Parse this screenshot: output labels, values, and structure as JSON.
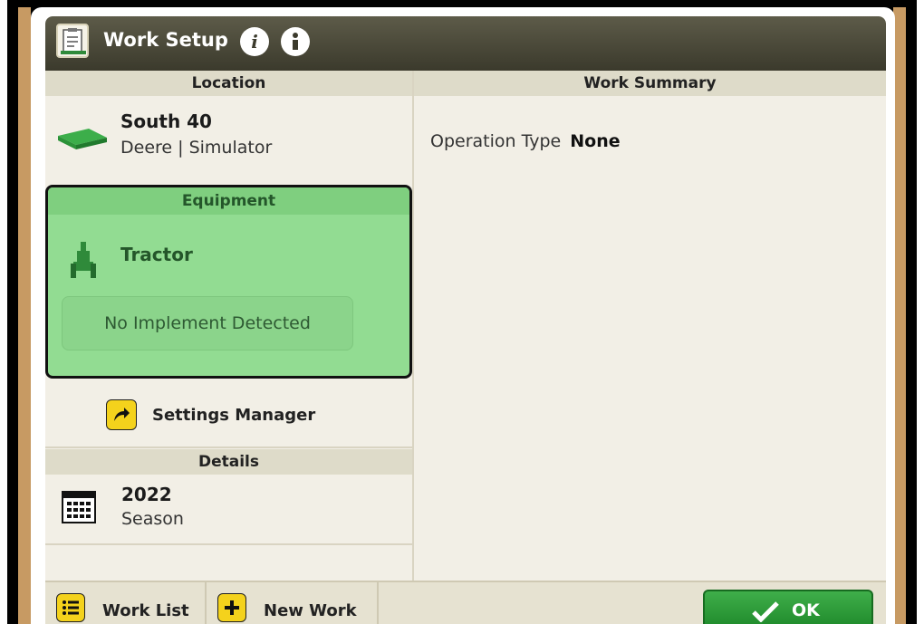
{
  "header": {
    "title": "Work Setup",
    "info_icons": [
      "info-icon",
      "info-detail-icon"
    ]
  },
  "location": {
    "header": "Location",
    "field_name": "South 40",
    "field_sub": "Deere | Simulator",
    "icon": "field-icon"
  },
  "equipment": {
    "header": "Equipment",
    "machine": "Tractor",
    "implement_status": "No Implement Detected",
    "highlight_color": "#92dc92",
    "icon": "tractor-icon"
  },
  "settings_manager": {
    "label": "Settings Manager",
    "icon": "arrow-share-icon"
  },
  "details": {
    "header": "Details",
    "season_year": "2022",
    "season_label": "Season",
    "icon": "calendar-icon"
  },
  "work_summary": {
    "header": "Work Summary",
    "operation_type_label": "Operation Type",
    "operation_type_value": "None"
  },
  "footer": {
    "work_list": "Work List",
    "new_work": "New Work",
    "ok": "OK",
    "ok_color": "#2a9c36",
    "button_color": "#f4d21c"
  }
}
